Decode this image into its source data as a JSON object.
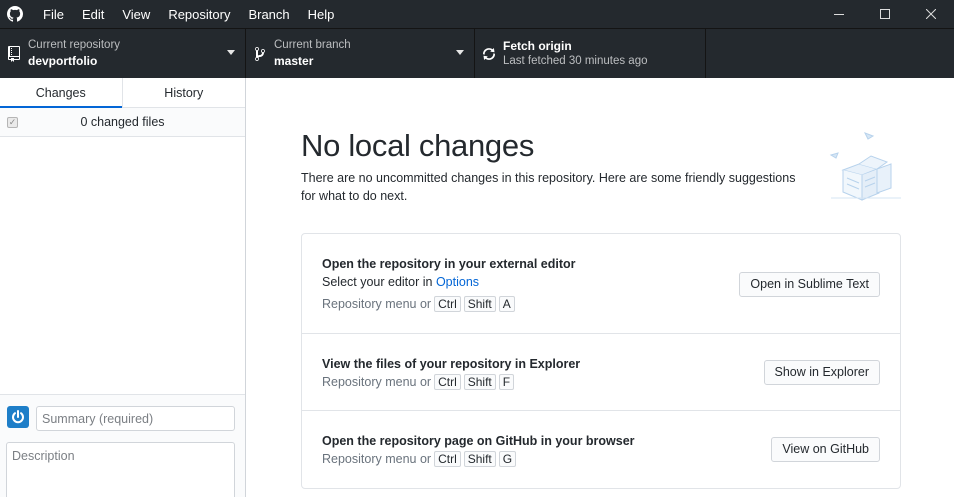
{
  "menu": [
    "File",
    "Edit",
    "View",
    "Repository",
    "Branch",
    "Help"
  ],
  "toolbar": {
    "repo_label": "Current repository",
    "repo_value": "devportfolio",
    "branch_label": "Current branch",
    "branch_value": "master",
    "fetch_label": "Fetch origin",
    "fetch_sub": "Last fetched 30 minutes ago"
  },
  "sidebar": {
    "tabs": [
      {
        "label": "Changes",
        "active": true
      },
      {
        "label": "History",
        "active": false
      }
    ],
    "changed_files": "0 changed files",
    "summary_placeholder": "Summary (required)",
    "description_placeholder": "Description"
  },
  "main": {
    "heading": "No local changes",
    "subtext": "There are no uncommitted changes in this repository. Here are some friendly suggestions for what to do next.",
    "suggestions": [
      {
        "title": "Open the repository in your external editor",
        "line_prefix": "Select your editor in ",
        "line_link": "Options",
        "hint": "Repository menu or",
        "keys": [
          "Ctrl",
          "Shift",
          "A"
        ],
        "button": "Open in Sublime Text"
      },
      {
        "title": "View the files of your repository in Explorer",
        "hint": "Repository menu or",
        "keys": [
          "Ctrl",
          "Shift",
          "F"
        ],
        "button": "Show in Explorer"
      },
      {
        "title": "Open the repository page on GitHub in your browser",
        "hint": "Repository menu or",
        "keys": [
          "Ctrl",
          "Shift",
          "G"
        ],
        "button": "View on GitHub"
      }
    ]
  },
  "colors": {
    "accent": "#0366d6",
    "toolbar_bg": "#24292e",
    "avatar": "#1e7ec8"
  },
  "icons": [
    "github-logo-icon",
    "minimize-icon",
    "maximize-icon",
    "close-icon",
    "repo-icon",
    "branch-icon",
    "sync-icon",
    "caret-down-icon",
    "checkbox-icon",
    "power-icon"
  ]
}
